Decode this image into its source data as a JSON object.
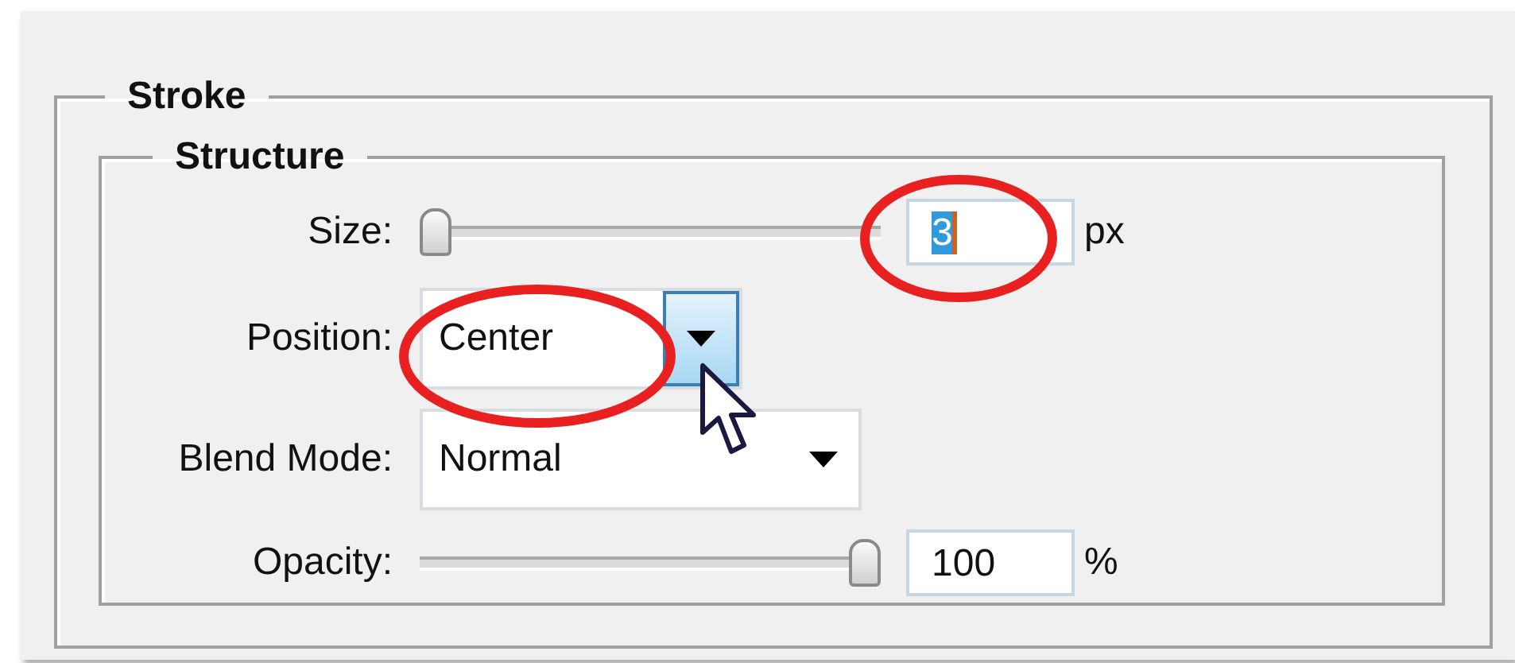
{
  "group": {
    "title": "Stroke",
    "subgroup": {
      "title": "Structure",
      "rows": [
        {
          "kind": "slider",
          "label": "Size:",
          "level": 0,
          "value": "3",
          "text_selected": true,
          "unit": "px"
        },
        {
          "kind": "dropdown",
          "label": "Position:",
          "value": "Center",
          "hovered": true
        },
        {
          "kind": "dropdown",
          "label": "Blend Mode:",
          "value": "Normal",
          "hovered": false
        },
        {
          "kind": "slider",
          "label": "Opacity:",
          "level": 1,
          "value": "100",
          "text_selected": false,
          "unit": "%"
        }
      ]
    }
  }
}
